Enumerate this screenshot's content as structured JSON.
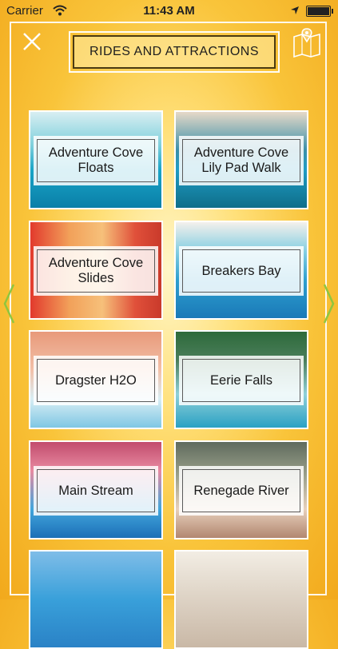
{
  "status_bar": {
    "carrier": "Carrier",
    "time": "11:43 AM"
  },
  "header": {
    "title": "RIDES AND ATTRACTIONS",
    "close_icon": "close-icon",
    "map_icon": "map-pin-icon"
  },
  "nav": {
    "prev_icon": "chevron-left-icon",
    "next_icon": "chevron-right-icon",
    "accent_color": "#8fc63f"
  },
  "attractions": [
    {
      "label": "Adventure Cove\nFloats"
    },
    {
      "label": "Adventure Cove\nLily Pad Walk"
    },
    {
      "label": "Adventure Cove\nSlides"
    },
    {
      "label": "Breakers Bay"
    },
    {
      "label": "Dragster H2O"
    },
    {
      "label": "Eerie Falls"
    },
    {
      "label": "Main Stream"
    },
    {
      "label": "Renegade River"
    },
    {
      "label": ""
    },
    {
      "label": ""
    }
  ]
}
